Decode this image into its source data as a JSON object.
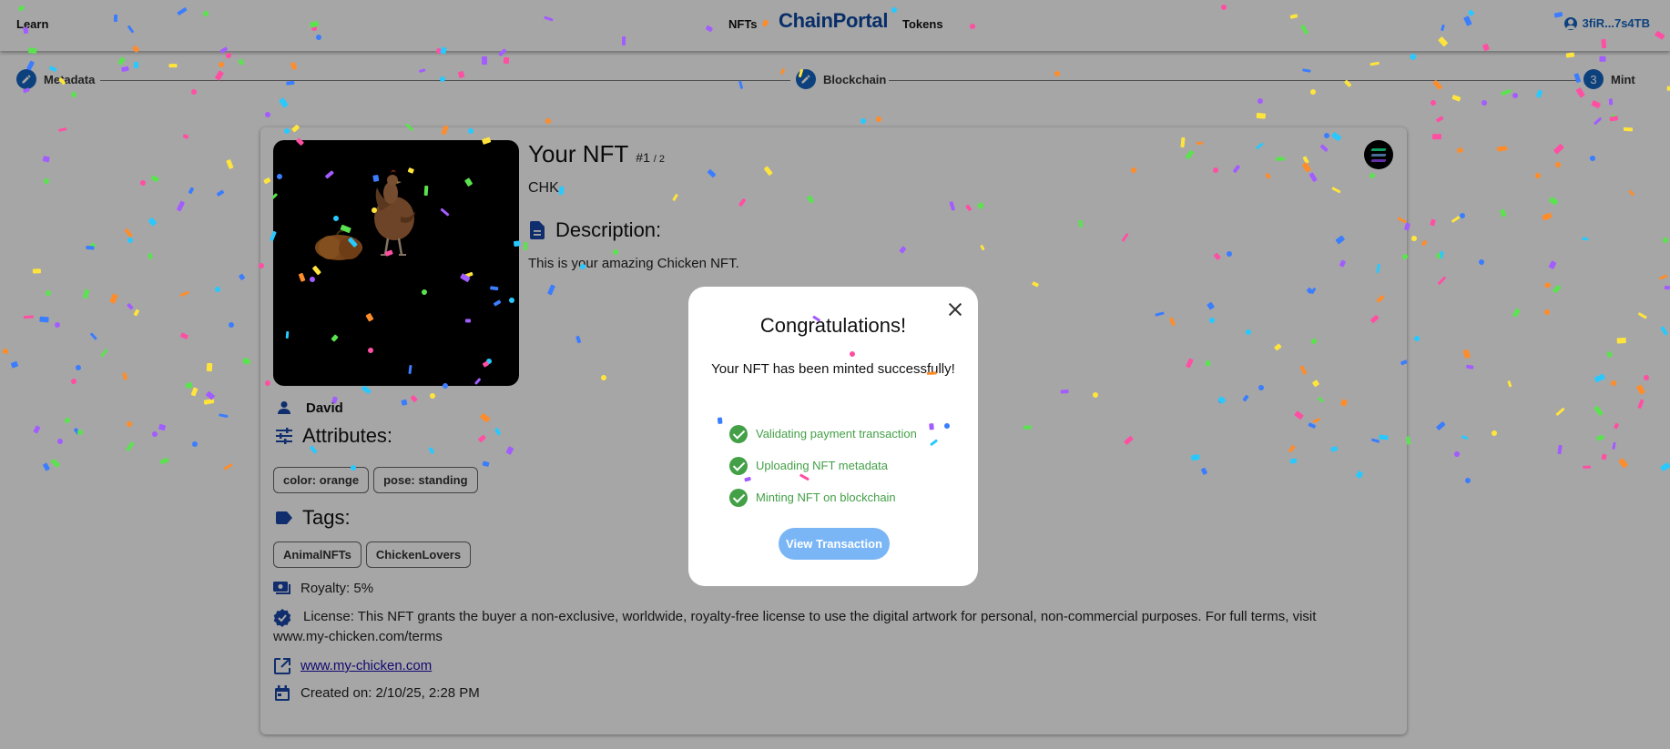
{
  "header": {
    "learn_label": "Learn",
    "nfts_label": "NFTs",
    "brand": "ChainPortal",
    "tokens_label": "Tokens",
    "wallet_address": "3fiR...7s4TB"
  },
  "stepper": {
    "steps": [
      {
        "label": "Metadata",
        "icon": "pencil-icon"
      },
      {
        "label": "Blockchain",
        "icon": "pencil-icon"
      },
      {
        "label": "Mint",
        "number": "3"
      }
    ]
  },
  "nft": {
    "title": "Your NFT",
    "edition": "#1",
    "edition_total": "/ 2",
    "symbol": "CHK",
    "description_heading": "Description:",
    "description": "This is your amazing Chicken NFT.",
    "creator": "David",
    "attributes_heading": "Attributes:",
    "attributes": [
      "color: orange",
      "pose: standing"
    ],
    "tags_heading": "Tags:",
    "tags": [
      "AnimalNFTs",
      "ChickenLovers"
    ],
    "royalty": "Royalty: 5%",
    "license": "License: This NFT grants the buyer a non-exclusive, worldwide, royalty-free license to use the digital artwork for personal, non-commercial purposes. For full terms, visit www.my-chicken.com/terms",
    "website": "www.my-chicken.com",
    "created_on": "Created on: 2/10/25, 2:28 PM"
  },
  "modal": {
    "title": "Congratulations!",
    "message": "Your NFT has been minted successfully!",
    "steps": [
      "Validating payment transaction",
      "Uploading NFT metadata",
      "Minting NFT on blockchain"
    ],
    "button_label": "View Transaction"
  },
  "colors": {
    "brand": "#0d47a1",
    "accent": "#1565c0",
    "success": "#43a047",
    "button": "#7ab6f5"
  }
}
